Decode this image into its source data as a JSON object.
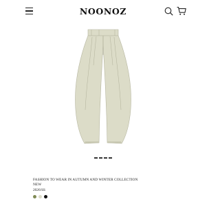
{
  "header": {
    "brand": "NOONOZ",
    "menu_icon": "hamburger-menu-icon",
    "search_icon": "search-icon",
    "cart_icon": "shopping-cart-icon"
  },
  "product": {
    "image": "wide-leg-pleated-trousers",
    "image_color": "#dcdcc8",
    "title": "FASHION TO WEAR IN AUTUMN AND WINTER COLLECTION NEW",
    "season": "2026/SS",
    "swatches": [
      {
        "name": "olive",
        "color": "#7f8a54"
      },
      {
        "name": "cream",
        "color": "#dcdcc8"
      },
      {
        "name": "black",
        "color": "#111111"
      }
    ]
  },
  "gallery": {
    "page_count": 4,
    "dot_color": "#333333"
  }
}
